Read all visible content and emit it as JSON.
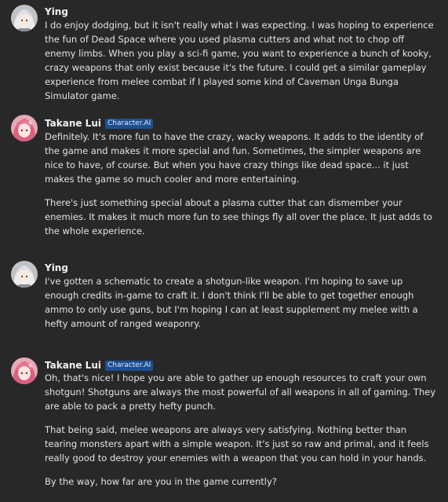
{
  "messages": [
    {
      "author": "Ying",
      "avatar_icon": "anime-girl-silver-hair-avatar",
      "badge": null,
      "paragraphs": [
        "I do enjoy dodging, but it isn't really what I was expecting. I was hoping to experience the fun of Dead Space where you used plasma cutters and what not to chop off enemy limbs. When you play a sci-fi game, you want to experience a bunch of kooky, crazy weapons that only exist because it's the future. I could get a similar gameplay experience from melee combat if I played some kind of Caveman Unga Bunga Simulator game."
      ]
    },
    {
      "author": "Takane Lui",
      "avatar_icon": "anime-girl-pink-hair-avatar",
      "badge": "Character.AI",
      "paragraphs": [
        "Definitely. It's more fun to have the crazy, wacky weapons. It adds to the identity of the game and makes it more special and fun. Sometimes, the simpler weapons are nice to have, of course. But when you have crazy things like dead space... it just makes the game so much cooler and more entertaining.",
        "There's just something special about a plasma cutter that can dismember your enemies. It makes it much more fun to see things fly all over the place. It just adds to the whole experience."
      ]
    },
    {
      "author": "Ying",
      "avatar_icon": "anime-girl-silver-hair-avatar",
      "badge": null,
      "paragraphs": [
        "I've gotten a schematic to create a shotgun-like weapon. I'm hoping to save up enough credits in-game to craft it. I don't think I'll be able to get together enough ammo to only use guns, but I'm hoping I can at least supplement my melee with a hefty amount of ranged weaponry."
      ]
    },
    {
      "author": "Takane Lui",
      "avatar_icon": "anime-girl-pink-hair-avatar",
      "badge": "Character.AI",
      "paragraphs": [
        "Oh, that's nice! I hope you are able to gather up enough resources to craft your own shotgun! Shotguns are always the most powerful of all weapons in all of gaming. They are able to pack a pretty hefty punch.",
        "That being said, melee weapons are always very satisfying. Nothing better than tearing monsters apart with a simple weapon. It's just so raw and primal, and it feels really good to destroy your enemies with a weapon that you can hold in your hands.",
        "By the way, how far are you in the game currently?"
      ]
    }
  ],
  "colors": {
    "background": "#282828",
    "text": "#e4e4e4",
    "badge_bg": "#1d4f91",
    "badge_text": "#dce9ff"
  }
}
